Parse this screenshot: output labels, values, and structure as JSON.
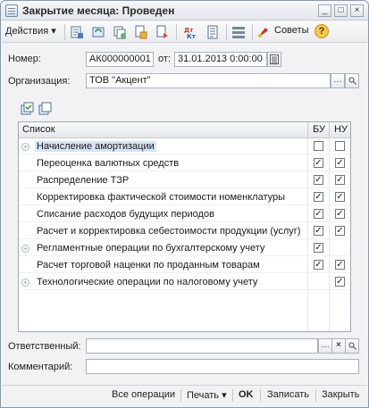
{
  "window": {
    "title": "Закрытие месяца: Проведен"
  },
  "toolbar": {
    "actions_label": "Действия",
    "sovety_label": "Советы",
    "help_label": "?"
  },
  "form": {
    "number_label": "Номер:",
    "number_value": "АК000000001",
    "date_label": "от:",
    "date_value": "31.01.2013  0:00:00",
    "org_label": "Организация:",
    "org_value": "ТОВ \"Акцент\""
  },
  "list": {
    "header": {
      "name": "Список",
      "bu": "БУ",
      "nu": "НУ"
    },
    "rows": [
      {
        "label": "Начисление амортизации",
        "expander": true,
        "bu": false,
        "nu": false,
        "selected": true
      },
      {
        "label": "Переоценка валютных средств",
        "expander": false,
        "bu": true,
        "nu": true
      },
      {
        "label": "Распределение ТЗР",
        "expander": false,
        "bu": true,
        "nu": true
      },
      {
        "label": "Корректировка фактической стоимости номенклатуры",
        "expander": false,
        "bu": true,
        "nu": true
      },
      {
        "label": "Списание расходов будущих периодов",
        "expander": false,
        "bu": true,
        "nu": true
      },
      {
        "label": "Расчет и корректировка себестоимости продукции (услуг)",
        "expander": false,
        "bu": true,
        "nu": true
      },
      {
        "label": "Регламентные операции по бухгалтерскому учету",
        "expander": true,
        "bu": true,
        "nu": null
      },
      {
        "label": "Расчет торговой наценки по проданным товарам",
        "expander": false,
        "bu": true,
        "nu": true
      },
      {
        "label": "Технологические операции по налоговому учету",
        "expander": true,
        "bu": null,
        "nu": true
      }
    ]
  },
  "footer_fields": {
    "responsible_label": "Ответственный:",
    "comment_label": "Комментарий:"
  },
  "bottom": {
    "all_ops": "Все операции",
    "print": "Печать",
    "ok": "OK",
    "save": "Записать",
    "close": "Закрыть"
  }
}
